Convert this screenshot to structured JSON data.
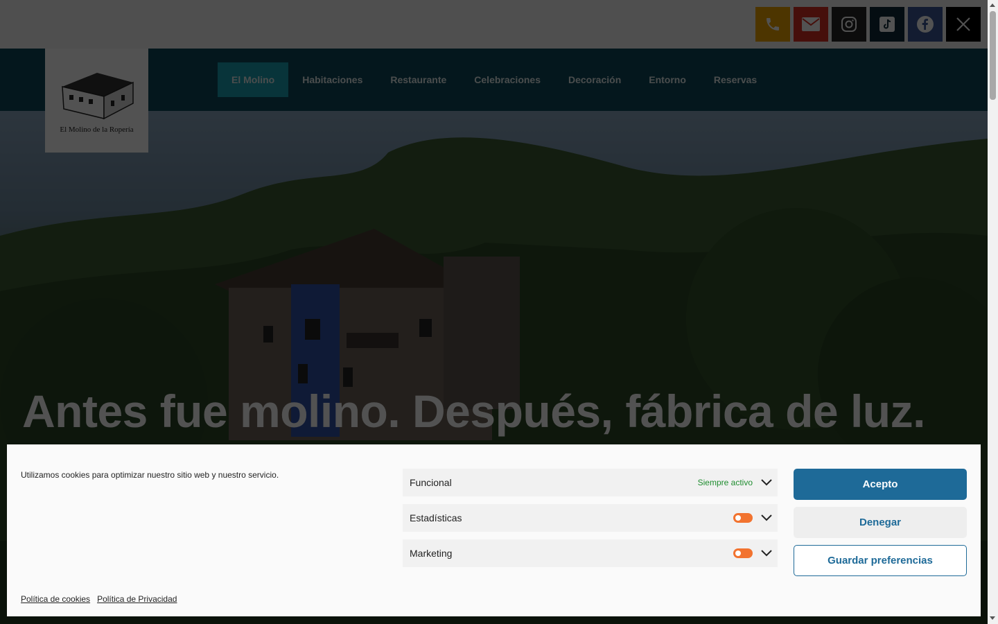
{
  "social": [
    {
      "name": "phone-icon",
      "color": "#f0a500"
    },
    {
      "name": "email-icon",
      "color": "#d93025"
    },
    {
      "name": "instagram-icon",
      "color": "#262626"
    },
    {
      "name": "tiktok-icon",
      "color": "#0e2a3a"
    },
    {
      "name": "facebook-icon",
      "color": "#3b5998"
    },
    {
      "name": "x-icon",
      "color": "#000000"
    }
  ],
  "logo": {
    "text": "El Molino de la Ropería"
  },
  "nav": {
    "items": [
      "El Molino",
      "Habitaciones",
      "Restaurante",
      "Celebraciones",
      "Decoración",
      "Entorno",
      "Reservas"
    ],
    "active": "El Molino"
  },
  "hero": {
    "title": "Antes fue molino. Después, fábrica de luz."
  },
  "cookie": {
    "message": "Utilizamos cookies para optimizar nuestro sitio web y nuestro servicio.",
    "categories": [
      {
        "label": "Funcional",
        "status": "Siempre activo"
      },
      {
        "label": "Estadísticas"
      },
      {
        "label": "Marketing"
      }
    ],
    "accept": "Acepto",
    "deny": "Denegar",
    "save": "Guardar preferencias",
    "links": [
      "Política de cookies",
      "Política de Privacidad"
    ]
  },
  "colors": {
    "accent": "#1e6a98",
    "nav": "#0f4a5c",
    "active_tab": "#1aa3b5",
    "toggle": "#f2732f"
  }
}
